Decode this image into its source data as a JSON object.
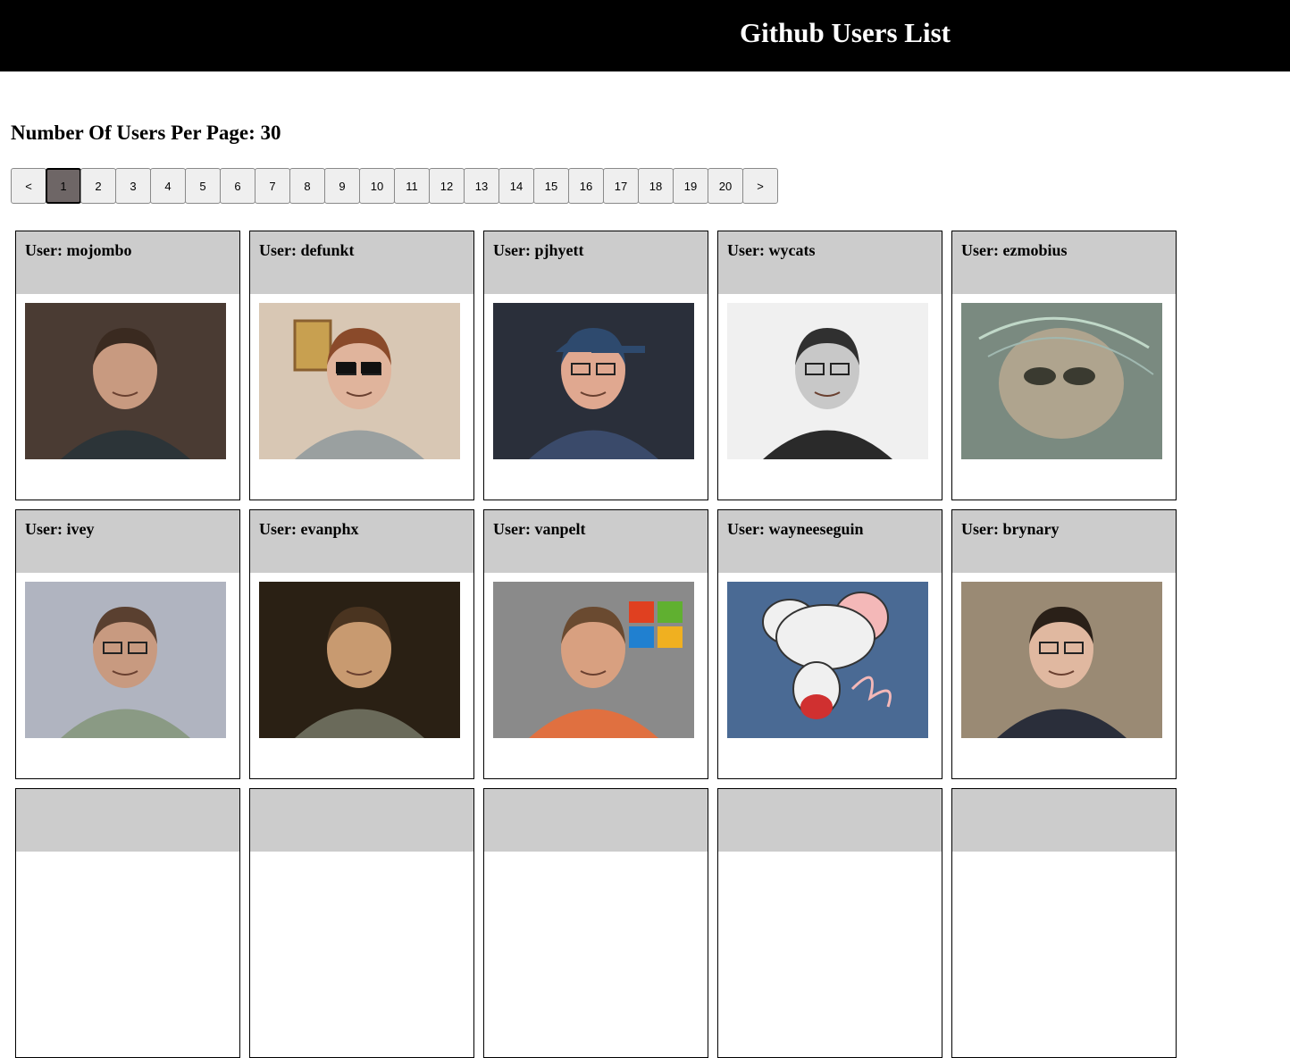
{
  "header": {
    "title": "Github Users List"
  },
  "per_page": {
    "label": "Number Of Users Per Page: 30"
  },
  "pagination": {
    "prev": "<",
    "next": ">",
    "pages": [
      "1",
      "2",
      "3",
      "4",
      "5",
      "6",
      "7",
      "8",
      "9",
      "10",
      "11",
      "12",
      "13",
      "14",
      "15",
      "16",
      "17",
      "18",
      "19",
      "20"
    ],
    "active": "1"
  },
  "users": [
    {
      "label": "User: mojombo",
      "avatar_desc": "man-portrait-dark-bg",
      "bg": "#4a3b33",
      "skin": "#c89a80",
      "hair": "#3a2a20",
      "shirt": "#2c3438"
    },
    {
      "label": "User: defunkt",
      "avatar_desc": "man-sunglasses-room",
      "bg": "#d8c7b4",
      "skin": "#e0b49c",
      "hair": "#8a4a2a",
      "shirt": "#9aa0a0"
    },
    {
      "label": "User: pjhyett",
      "avatar_desc": "man-cap-glasses",
      "bg": "#2a2f3a",
      "skin": "#e0a890",
      "hair": "#2e4a6e",
      "shirt": "#3a4a6a"
    },
    {
      "label": "User: wycats",
      "avatar_desc": "man-bw-glasses",
      "bg": "#f0f0f0",
      "skin": "#c8c8c8",
      "hair": "#303030",
      "shirt": "#2a2a2a"
    },
    {
      "label": "User: ezmobius",
      "avatar_desc": "alien-artwork",
      "bg": "#7a8a80",
      "skin": "#b8a890",
      "hair": "#5a6a70",
      "shirt": "#8a7a6a"
    },
    {
      "label": "User: ivey",
      "avatar_desc": "man-phone-sweater",
      "bg": "#b0b4c0",
      "skin": "#c89a80",
      "hair": "#5a4030",
      "shirt": "#8a9a84"
    },
    {
      "label": "User: evanphx",
      "avatar_desc": "man-gesturing-dark",
      "bg": "#2a2014",
      "skin": "#c89a70",
      "hair": "#4a3420",
      "shirt": "#6a6a5a"
    },
    {
      "label": "User: vanpelt",
      "avatar_desc": "man-orange-shirt-logo",
      "bg": "#8a8a8a",
      "skin": "#d8a080",
      "hair": "#6a4a30",
      "shirt": "#e07040"
    },
    {
      "label": "User: wayneeseguin",
      "avatar_desc": "cartoon-mouse",
      "bg": "#4a6a94",
      "skin": "#f0f0f0",
      "hair": "#f4b8b8",
      "shirt": "#d03030"
    },
    {
      "label": "User: brynary",
      "avatar_desc": "man-glasses-suit",
      "bg": "#9a8a74",
      "skin": "#e0b8a0",
      "hair": "#2a2018",
      "shirt": "#2a2e3a"
    }
  ]
}
